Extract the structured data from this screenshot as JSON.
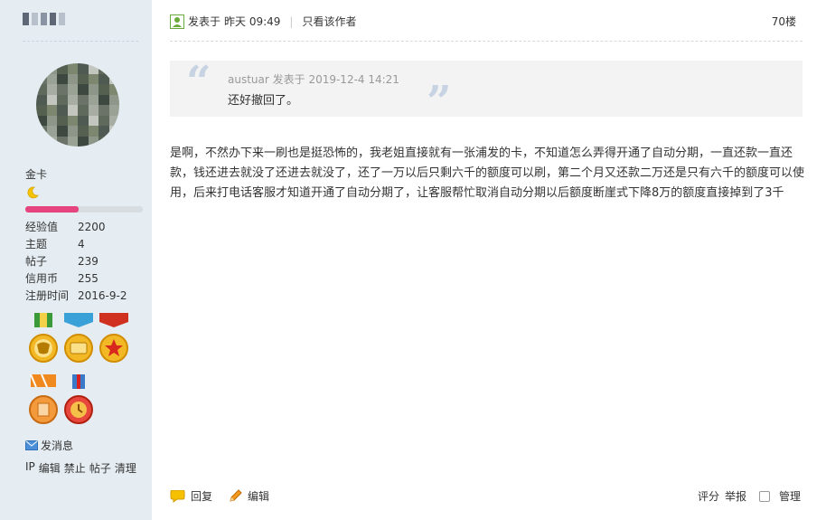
{
  "user": {
    "rank": "金卡",
    "stats": [
      {
        "label": "经验值",
        "value": "2200"
      },
      {
        "label": "主题",
        "value": "4"
      },
      {
        "label": "帖子",
        "value": "239"
      },
      {
        "label": "信用币",
        "value": "255"
      },
      {
        "label": "注册时间",
        "value": "2016-9-2"
      }
    ],
    "level_progress": 0.45,
    "send_message": "发消息",
    "admin_links": [
      "IP",
      "编辑",
      "禁止",
      "帖子",
      "清理"
    ]
  },
  "post": {
    "posted_label": "发表于",
    "posted_time": "昨天 09:49",
    "only_author": "只看该作者",
    "floor": "70楼",
    "quote": {
      "meta": "austuar 发表于 2019-12-4 14:21",
      "text": "还好撤回了。"
    },
    "content": "是啊，不然办下来一刷也是挺恐怖的，我老姐直接就有一张浦发的卡，不知道怎么弄得开通了自动分期，一直还款一直还款，钱还进去就没了还进去就没了，还了一万以后只剩六千的额度可以刷，第二个月又还款二万还是只有六千的额度可以使用，后来打电话客服才知道开通了自动分期了，让客服帮忙取消自动分期以后额度断崖式下降8万的额度直接掉到了3千",
    "actions": {
      "reply": "回复",
      "edit": "编辑",
      "rate": "评分",
      "report": "举报",
      "manage": "管理"
    }
  },
  "colors": {
    "sidebar_bg": "#e5edf2",
    "progress_fill": "#e6447e",
    "quote_bg": "#f3f3f3",
    "quote_mark": "#c7d3e2"
  },
  "icons": [
    "user-post-icon",
    "moon-icon",
    "medal-icons",
    "mail-icon",
    "reply-icon",
    "pencil-icon"
  ]
}
